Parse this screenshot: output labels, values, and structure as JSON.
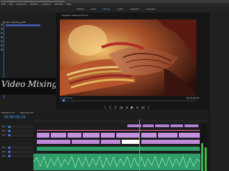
{
  "app": {
    "title": "C:\\Users\\Editor\\Videos\\Wedding_Project\\Wedding_Edit.prproj",
    "menu": [
      "Edit",
      "Clip",
      "Sequence",
      "Markers",
      "Graphics",
      "Window",
      "Help"
    ]
  },
  "workspaces": {
    "tabs": [
      "Editing",
      "Color",
      "Effects",
      "Audio",
      "Graphics",
      "Libraries"
    ],
    "active": "Effects"
  },
  "project": {
    "tab": "Project: Wedding_Edit",
    "clip": "Wedding_Clip_01.mp4"
  },
  "watermark": {
    "text": "Video Mixing"
  },
  "program": {
    "title": "Program: Sequence 01 ≡",
    "timecode_left": "00:00:00:10",
    "timecode_right": "00:00:06:12"
  },
  "controls": [
    "⟨",
    "{",
    "}",
    "|◂",
    "◂",
    "▶",
    "▸",
    "▸|",
    "⟩"
  ],
  "timeline": {
    "tabs": [
      "Sequence 01",
      "Sequence 02"
    ],
    "timecode": "00:00:00:10",
    "tracks": [
      "V3",
      "V2",
      "V1",
      "A1",
      "A2",
      "A3"
    ]
  },
  "colors": {
    "accent": "#4da0ff",
    "video_clip": "#c492e0",
    "effect_clip": "#ff6fb2",
    "audio_clip": "#2f9e6a"
  }
}
